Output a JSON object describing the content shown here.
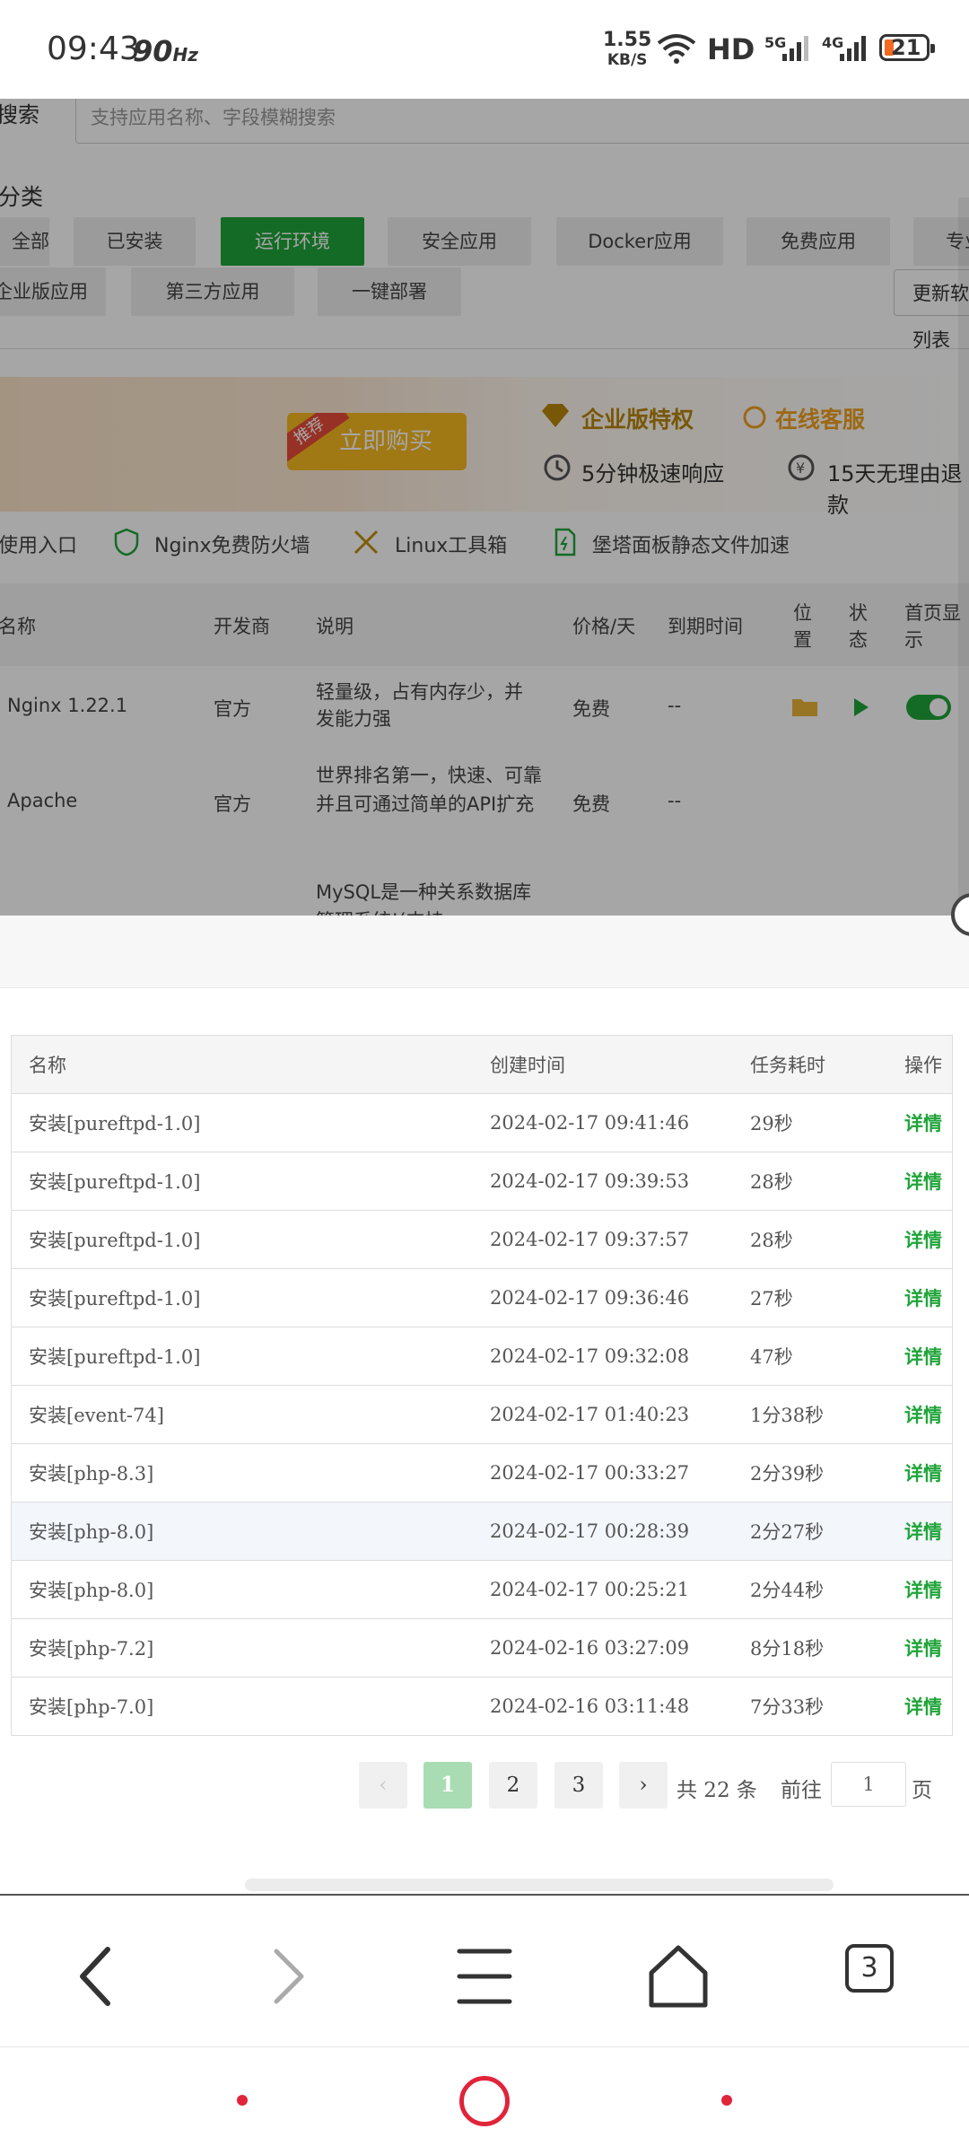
{
  "status_bar": {
    "time": "09:43",
    "refresh_rate": "90",
    "refresh_unit": "Hz",
    "speed_value": "1.55",
    "speed_unit": "KB/S",
    "hd_label": "HD",
    "network_1": "5G",
    "network_2": "4G",
    "battery": "21"
  },
  "background_page": {
    "search_label": "搜索",
    "search_placeholder": "支持应用名称、字段模糊搜索",
    "category_label": "分类",
    "categories_row1": [
      "全部",
      "已安装",
      "运行环境",
      "安全应用",
      "Docker应用",
      "免费应用",
      "专业版应用"
    ],
    "categories_row2": [
      "企业版应用",
      "第三方应用",
      "一键部署"
    ],
    "active_category": "运行环境",
    "update_button": "更新软件列表",
    "banner": {
      "ribbon": "推荐",
      "buy_button": "立即购买",
      "enterprise": "企业版特权",
      "online_service": "在线客服",
      "response": "5分钟极速响应",
      "refund": "15天无理由退款"
    },
    "tools": [
      "使用入口",
      "Nginx免费防火墙",
      "Linux工具箱",
      "堡塔面板静态文件加速"
    ],
    "table_headers": [
      "名称",
      "开发商",
      "说明",
      "价格/天",
      "到期时间",
      "位置",
      "状态",
      "首页显示"
    ],
    "rows": [
      {
        "name": "Nginx 1.22.1",
        "vendor": "官方",
        "desc": "轻量级，占有内存少，并发能力强",
        "price": "免费",
        "expire": "--"
      },
      {
        "name": "Apache",
        "vendor": "官方",
        "desc": "世界排名第一，快速、可靠并且可通过简单的API扩充",
        "price": "免费",
        "expire": "--"
      },
      {
        "name": "",
        "vendor": "",
        "desc": "MySQL是一种关系数据库管理系统!(支持",
        "price": "",
        "expire": ""
      }
    ]
  },
  "tasks": {
    "headers": [
      "名称",
      "创建时间",
      "任务耗时",
      "操作"
    ],
    "rows": [
      {
        "name": "安装[pureftpd-1.0]",
        "time": "2024-02-17 09:41:46",
        "duration": "29秒",
        "action": "详情"
      },
      {
        "name": "安装[pureftpd-1.0]",
        "time": "2024-02-17 09:39:53",
        "duration": "28秒",
        "action": "详情"
      },
      {
        "name": "安装[pureftpd-1.0]",
        "time": "2024-02-17 09:37:57",
        "duration": "28秒",
        "action": "详情"
      },
      {
        "name": "安装[pureftpd-1.0]",
        "time": "2024-02-17 09:36:46",
        "duration": "27秒",
        "action": "详情"
      },
      {
        "name": "安装[pureftpd-1.0]",
        "time": "2024-02-17 09:32:08",
        "duration": "47秒",
        "action": "详情"
      },
      {
        "name": "安装[event-74]",
        "time": "2024-02-17 01:40:23",
        "duration": "1分38秒",
        "action": "详情"
      },
      {
        "name": "安装[php-8.3]",
        "time": "2024-02-17 00:33:27",
        "duration": "2分39秒",
        "action": "详情"
      },
      {
        "name": "安装[php-8.0]",
        "time": "2024-02-17 00:28:39",
        "duration": "2分27秒",
        "action": "详情"
      },
      {
        "name": "安装[php-8.0]",
        "time": "2024-02-17 00:25:21",
        "duration": "2分44秒",
        "action": "详情"
      },
      {
        "name": "安装[php-7.2]",
        "time": "2024-02-16 03:27:09",
        "duration": "8分18秒",
        "action": "详情"
      },
      {
        "name": "安装[php-7.0]",
        "time": "2024-02-16 03:11:48",
        "duration": "7分33秒",
        "action": "详情"
      }
    ]
  },
  "pagination": {
    "prev": "‹",
    "pages": [
      "1",
      "2",
      "3"
    ],
    "current": "1",
    "next": "›",
    "total": "共 22 条",
    "goto_label": "前往",
    "goto_value": "1",
    "page_suffix": "页"
  },
  "browser_bar": {
    "tab_count": "3"
  },
  "colors": {
    "accent": "#20a53a",
    "accent_light": "#a9dcb3",
    "system_nav": "#e0243a",
    "battery": "#f26b21"
  }
}
